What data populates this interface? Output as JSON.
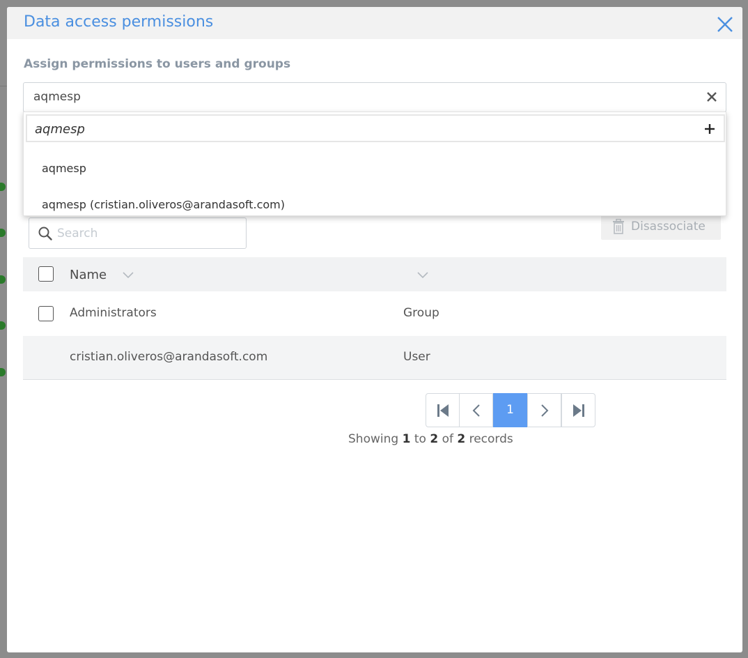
{
  "modal": {
    "title": "Data access permissions"
  },
  "assign": {
    "label": "Assign permissions to users and groups",
    "value": "aqmesp"
  },
  "dropdown": {
    "new_entry": "aqmesp",
    "options": [
      "aqmesp",
      "aqmesp (cristian.oliveros@arandasoft.com)"
    ]
  },
  "search": {
    "placeholder": "Search"
  },
  "toolbar": {
    "disassociate_label": "Disassociate"
  },
  "table": {
    "headers": [
      "Name",
      ""
    ],
    "rows": [
      {
        "name": "Administrators",
        "type": "Group"
      },
      {
        "name": "cristian.oliveros@arandasoft.com",
        "type": "User"
      }
    ]
  },
  "pagination": {
    "current_page": "1",
    "showing_label": "Showing",
    "from": "1",
    "to_label": "to",
    "to": "2",
    "of_label": "of",
    "total": "2",
    "records_label": "records"
  },
  "colors": {
    "accent": "#4a8fe0",
    "active_page": "#5d9cf2"
  }
}
